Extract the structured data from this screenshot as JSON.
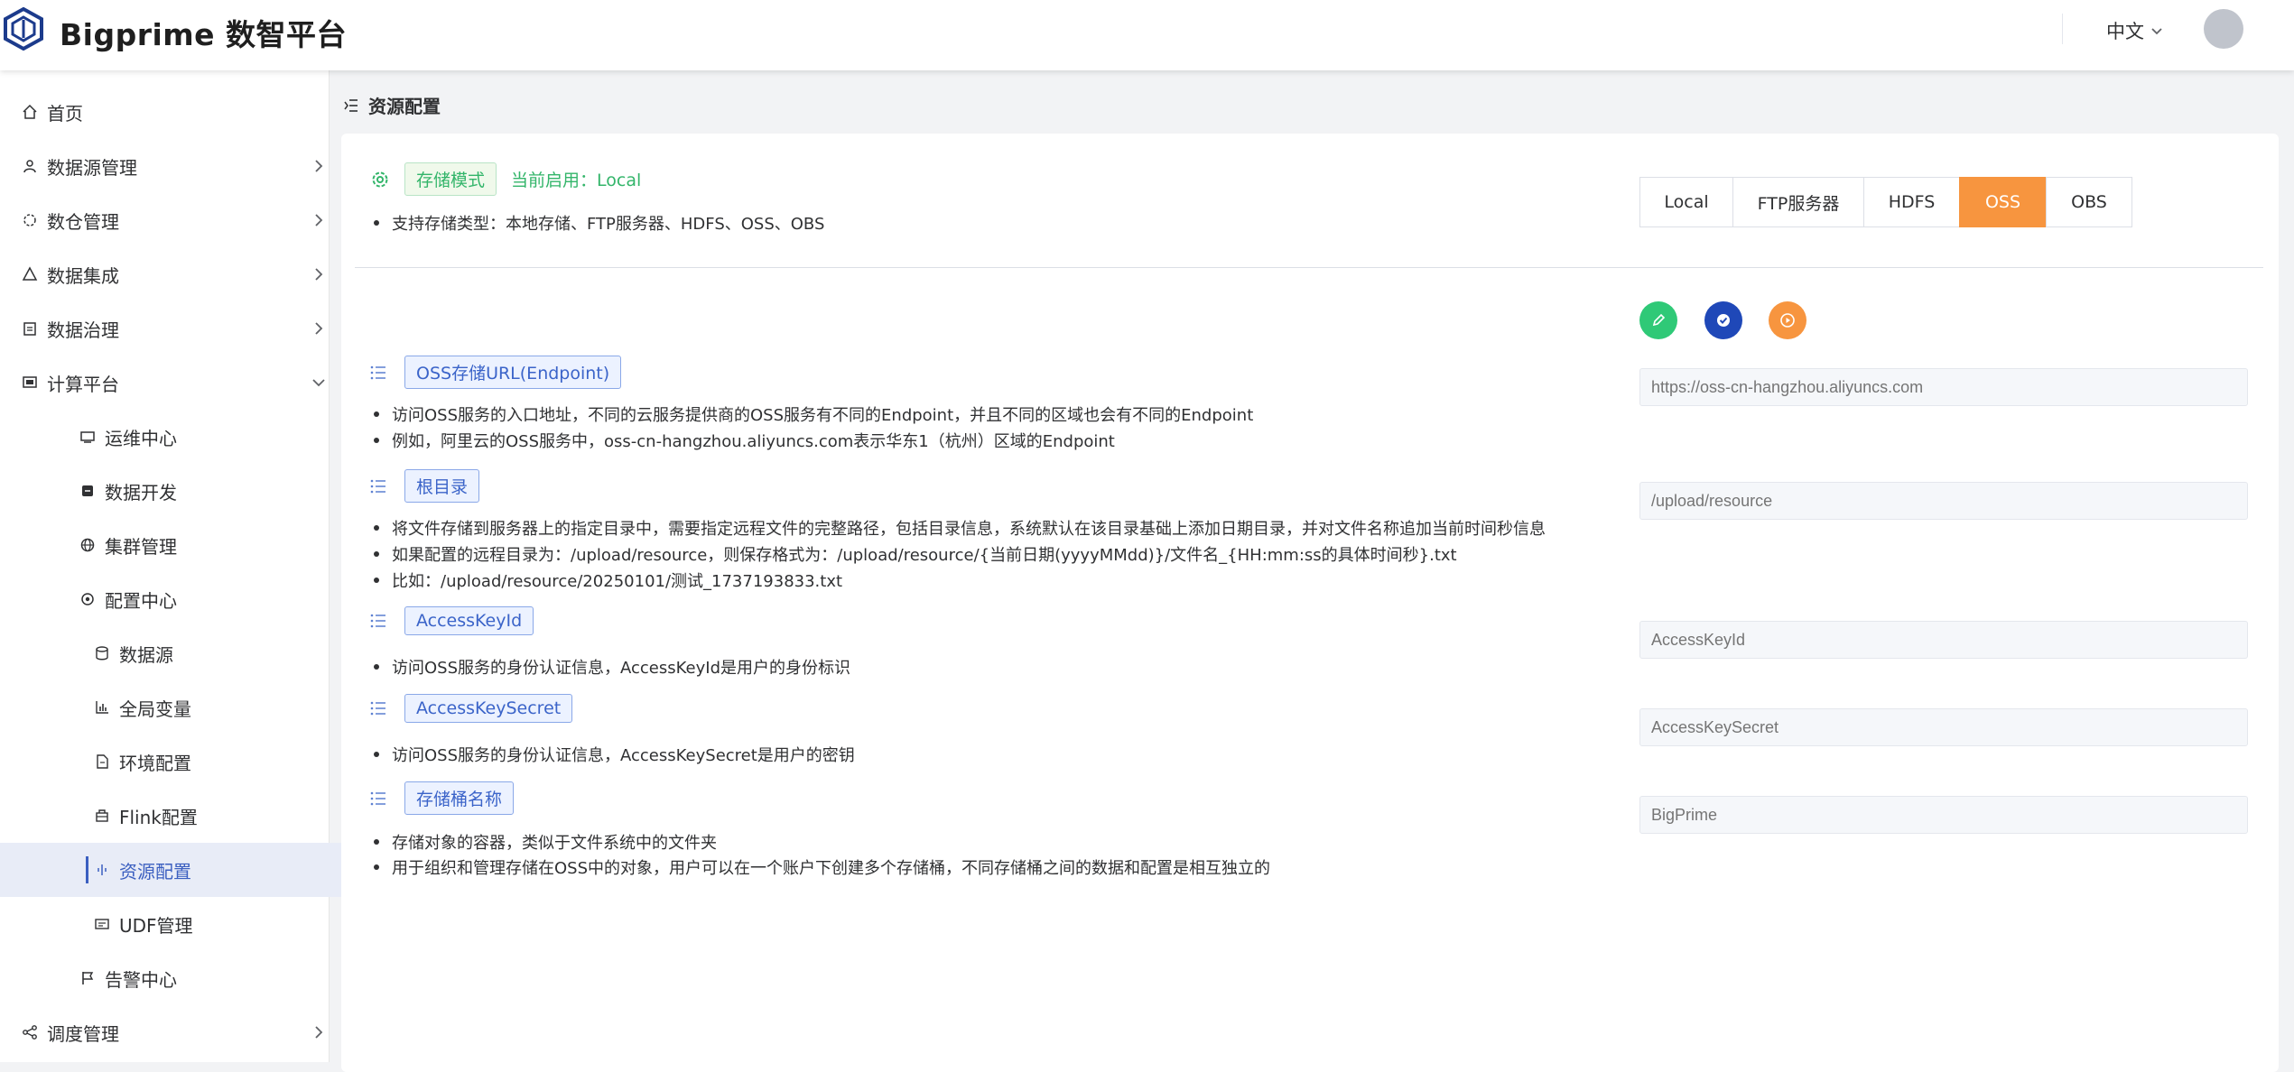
{
  "header": {
    "brand": "Bigprime 数智平台",
    "language": "中文"
  },
  "sidebar": {
    "items": [
      {
        "label": "首页",
        "icon": "home-icon"
      },
      {
        "label": "数据源管理",
        "icon": "datasource-icon"
      },
      {
        "label": "数仓管理",
        "icon": "warehouse-icon"
      },
      {
        "label": "数据集成",
        "icon": "integration-icon"
      },
      {
        "label": "数据治理",
        "icon": "governance-icon"
      },
      {
        "label": "计算平台",
        "icon": "compute-icon"
      },
      {
        "label": "运维中心",
        "icon": "monitor-icon"
      },
      {
        "label": "数据开发",
        "icon": "dev-icon"
      },
      {
        "label": "集群管理",
        "icon": "globe-icon"
      },
      {
        "label": "配置中心",
        "icon": "settings-icon"
      },
      {
        "label": "数据源",
        "icon": "database-icon"
      },
      {
        "label": "全局变量",
        "icon": "chart-icon"
      },
      {
        "label": "环境配置",
        "icon": "file-icon"
      },
      {
        "label": "Flink配置",
        "icon": "flink-icon"
      },
      {
        "label": "资源配置",
        "icon": "resource-icon"
      },
      {
        "label": "UDF管理",
        "icon": "udf-icon"
      },
      {
        "label": "告警中心",
        "icon": "flag-icon"
      },
      {
        "label": "调度管理",
        "icon": "share-icon"
      }
    ]
  },
  "breadcrumb": "资源配置",
  "storage": {
    "mode_tag": "存储模式",
    "current": "当前启用：Local",
    "supported": "支持存储类型：本地存储、FTP服务器、HDFS、OSS、OBS",
    "options": [
      "Local",
      "FTP服务器",
      "HDFS",
      "OSS",
      "OBS"
    ],
    "selected": "OSS"
  },
  "sections": [
    {
      "title": "OSS存储URL(Endpoint)",
      "desc": [
        "访问OSS服务的入口地址，不同的云服务提供商的OSS服务有不同的Endpoint，并且不同的区域也会有不同的Endpoint",
        "例如，阿里云的OSS服务中，oss-cn-hangzhou.aliyuncs.com表示华东1（杭州）区域的Endpoint"
      ],
      "placeholder": "https://oss-cn-hangzhou.aliyuncs.com"
    },
    {
      "title": "根目录",
      "desc": [
        "将文件存储到服务器上的指定目录中，需要指定远程文件的完整路径，包括目录信息，系统默认在该目录基础上添加日期目录，并对文件名称追加当前时间秒信息",
        "如果配置的远程目录为：/upload/resource，则保存格式为：/upload/resource/{当前日期(yyyyMMdd)}/文件名_{HH:mm:ss的具体时间秒}.txt",
        "比如：/upload/resource/20250101/测试_1737193833.txt"
      ],
      "placeholder": "/upload/resource"
    },
    {
      "title": "AccessKeyId",
      "desc": [
        "访问OSS服务的身份认证信息，AccessKeyId是用户的身份标识"
      ],
      "placeholder": "AccessKeyId"
    },
    {
      "title": "AccessKeySecret",
      "desc": [
        "访问OSS服务的身份认证信息，AccessKeySecret是用户的密钥"
      ],
      "placeholder": "AccessKeySecret"
    },
    {
      "title": "存储桶名称",
      "desc": [
        "存储对象的容器，类似于文件系统中的文件夹",
        "用于组织和管理存储在OSS中的对象，用户可以在一个账户下创建多个存储桶，不同存储桶之间的数据和配置是相互独立的"
      ],
      "placeholder": "BigPrime"
    }
  ],
  "colors": {
    "accent_blue": "#3b5fc0",
    "oss_selected": "#f7953f",
    "edit_green": "#2fc977",
    "check_blue": "#1f48b8",
    "play_orange": "#f7953f",
    "tag_green": "#33b56a"
  }
}
